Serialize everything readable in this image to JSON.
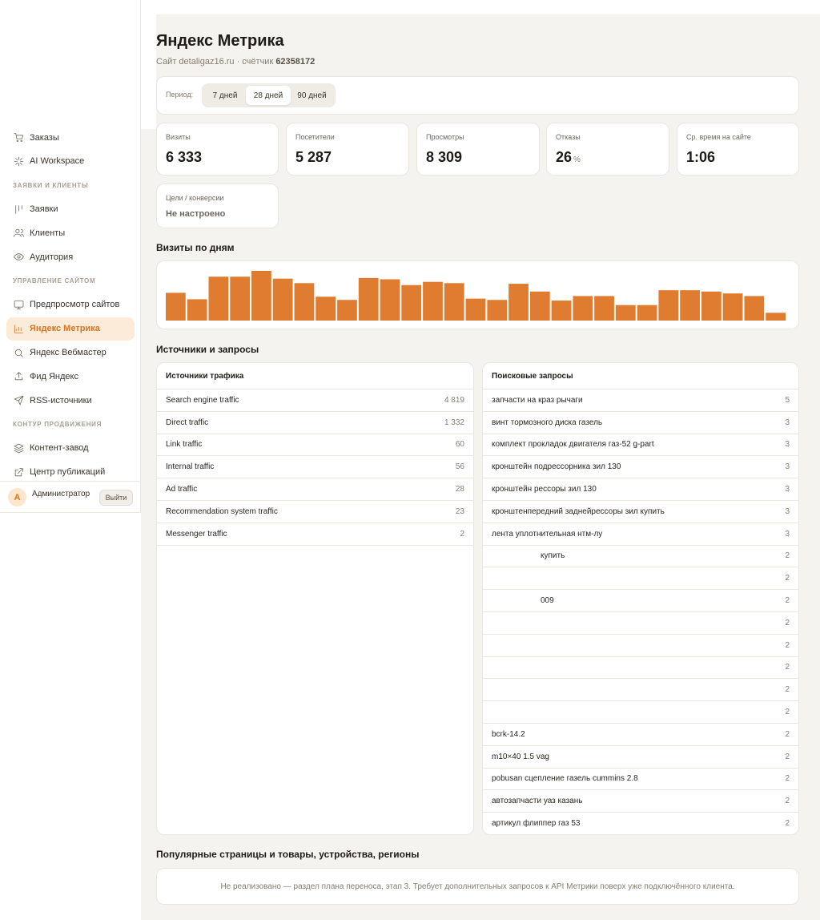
{
  "sidebar": {
    "items": [
      {
        "label": "Заказы",
        "icon": "cart-icon",
        "name": "sidebar-item-orders"
      },
      {
        "label": "AI Workspace",
        "icon": "sparkle-icon",
        "name": "sidebar-item-ai-workspace"
      }
    ],
    "section_leads": "Заявки и клиенты",
    "leads_items": [
      {
        "label": "Заявки",
        "icon": "kanban-icon",
        "name": "sidebar-item-requests"
      },
      {
        "label": "Клиенты",
        "icon": "users-icon",
        "name": "sidebar-item-clients"
      },
      {
        "label": "Аудитория",
        "icon": "eye-icon",
        "name": "sidebar-item-audience"
      }
    ],
    "section_site": "Управление сайтом",
    "site_items": [
      {
        "label": "Предпросмотр сайтов",
        "icon": "monitor-icon",
        "name": "sidebar-item-site-preview"
      },
      {
        "label": "Яндекс Метрика",
        "icon": "bar-chart-icon",
        "name": "sidebar-item-yandex-metrika",
        "active": true
      },
      {
        "label": "Яндекс Вебмастер",
        "icon": "search-icon",
        "name": "sidebar-item-yandex-webmaster"
      },
      {
        "label": "Фид Яндекс",
        "icon": "upload-icon",
        "name": "sidebar-item-yandex-feed"
      },
      {
        "label": "RSS-источники",
        "icon": "send-icon",
        "name": "sidebar-item-rss"
      }
    ],
    "section_promo": "Контур продвижения",
    "promo_items": [
      {
        "label": "Контент-завод",
        "icon": "layers-icon",
        "name": "sidebar-item-content-factory"
      },
      {
        "label": "Центр публикаций",
        "icon": "external-link-icon",
        "name": "sidebar-item-publish-center"
      }
    ],
    "user": {
      "avatar_letter": "А",
      "name": "Администратор",
      "logout_label": "Выйти"
    }
  },
  "header": {
    "title": "Яндекс Метрика",
    "subtitle_prefix": "Сайт detaligaz16.ru · счётчик ",
    "counter_id": "62358172"
  },
  "period": {
    "label": "Период:",
    "options": [
      "7 дней",
      "28 дней",
      "90 дней"
    ],
    "selected": "28 дней"
  },
  "stats": [
    {
      "label": "Визиты",
      "value": "6 333",
      "unit": ""
    },
    {
      "label": "Посетители",
      "value": "5 287",
      "unit": ""
    },
    {
      "label": "Просмотры",
      "value": "8 309",
      "unit": ""
    },
    {
      "label": "Отказы",
      "value": "26",
      "unit": "%"
    },
    {
      "label": "Ср. время на сайте",
      "value": "1:06",
      "unit": ""
    }
  ],
  "goals": {
    "label": "Цели / конверсии",
    "value": "Не настроено"
  },
  "visits_chart_title": "Визиты по дням",
  "visits_chart": {
    "type": "bar",
    "color": "#e07c2f",
    "values": [
      215,
      165,
      340,
      340,
      385,
      325,
      290,
      185,
      160,
      330,
      320,
      275,
      300,
      290,
      170,
      160,
      285,
      225,
      155,
      190,
      190,
      120,
      120,
      235,
      235,
      225,
      210,
      190,
      60
    ]
  },
  "sources_section_title": "Источники и запросы",
  "traffic_sources": {
    "title": "Источники трафика",
    "rows": [
      {
        "name": "Search engine traffic",
        "count": "4 819"
      },
      {
        "name": "Direct traffic",
        "count": "1 332"
      },
      {
        "name": "Link traffic",
        "count": "60"
      },
      {
        "name": "Internal traffic",
        "count": "56"
      },
      {
        "name": "Ad traffic",
        "count": "28"
      },
      {
        "name": "Recommendation system traffic",
        "count": "23"
      },
      {
        "name": "Messenger traffic",
        "count": "2"
      }
    ]
  },
  "search_queries": {
    "title": "Поисковые запросы",
    "rows": [
      {
        "q": "запчасти на краз рычаги",
        "count": "5"
      },
      {
        "q": "винт тормозного диска газель",
        "count": "3"
      },
      {
        "q": "комплект прокладок двигателя газ-52 g-part",
        "count": "3"
      },
      {
        "q": "кронштейн подрессорника зил 130",
        "count": "3"
      },
      {
        "q": "кронштейн рессоры зил 130",
        "count": "3"
      },
      {
        "q": "кронштенпередний заднейрессоры зил купить",
        "count": "3"
      },
      {
        "q": "лента уплотнительная нтм-лу",
        "count": "3"
      },
      {
        "q": "купить",
        "count": "2",
        "indent": true
      },
      {
        "q": "",
        "count": "2"
      },
      {
        "q": "009",
        "count": "2",
        "indent": true
      },
      {
        "q": "",
        "count": "2"
      },
      {
        "q": "",
        "count": "2"
      },
      {
        "q": "",
        "count": "2"
      },
      {
        "q": "",
        "count": "2"
      },
      {
        "q": "",
        "count": "2"
      },
      {
        "q": "bcrk-14.2",
        "count": "2"
      },
      {
        "q": "m10×40 1.5 vag",
        "count": "2"
      },
      {
        "q": "pobusan сцепление газель cummins 2.8",
        "count": "2"
      },
      {
        "q": "автозапчасти уаз казань",
        "count": "2"
      },
      {
        "q": "артикул флиппер газ 53",
        "count": "2"
      }
    ]
  },
  "popular_section_title": "Популярные страницы и товары, устройства, регионы",
  "popular_note": "Не реализовано — раздел плана переноса, этап 3. Требует дополнительных запросов к API Метрики поверх уже подключённого клиента."
}
